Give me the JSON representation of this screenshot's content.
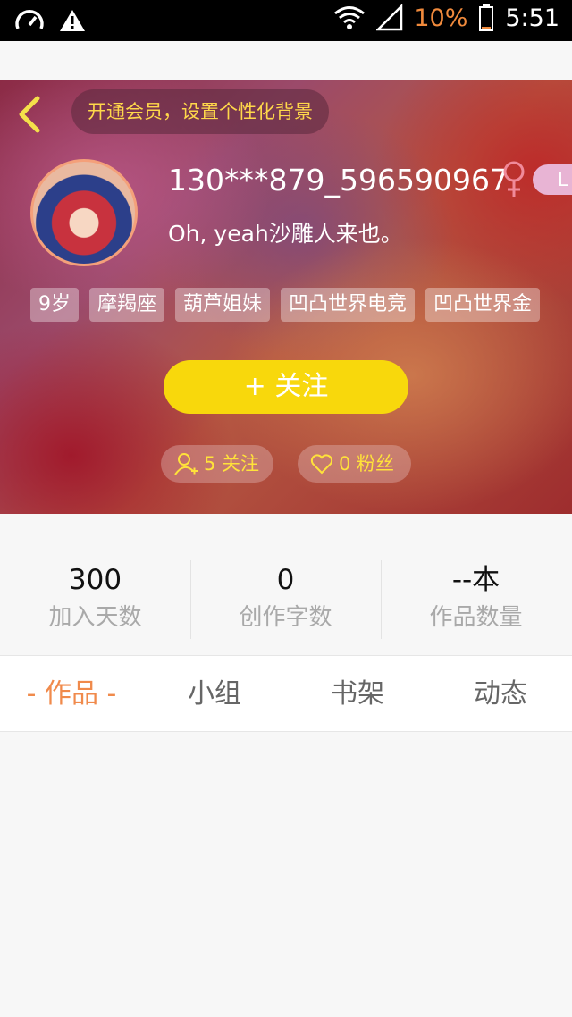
{
  "status_bar": {
    "battery_percent": "10%",
    "time": "5:51"
  },
  "header": {
    "vip_banner": "开通会员，设置个性化背景"
  },
  "profile": {
    "nickname": "130***879_596590967",
    "gender": "female",
    "level_badge": "L",
    "motto": "Oh, yeah沙雕人来也。",
    "tags": [
      "9岁",
      "摩羯座",
      "葫芦姐妹",
      "凹凸世界电竞",
      "凹凸世界金"
    ],
    "follow_button": "+ 关注",
    "following_label": "5 关注",
    "fans_label": "0 粉丝"
  },
  "stats": [
    {
      "value": "300",
      "label": "加入天数"
    },
    {
      "value": "0",
      "label": "创作字数"
    },
    {
      "value": "--本",
      "label": "作品数量"
    }
  ],
  "tabs": [
    {
      "label": "- 作品 -",
      "active": true
    },
    {
      "label": "小组",
      "active": false
    },
    {
      "label": "书架",
      "active": false
    },
    {
      "label": "动态",
      "active": false
    }
  ],
  "colors": {
    "accent_yellow": "#f8d80c",
    "tab_active": "#f08a4b",
    "battery_low": "#f08a3c"
  }
}
